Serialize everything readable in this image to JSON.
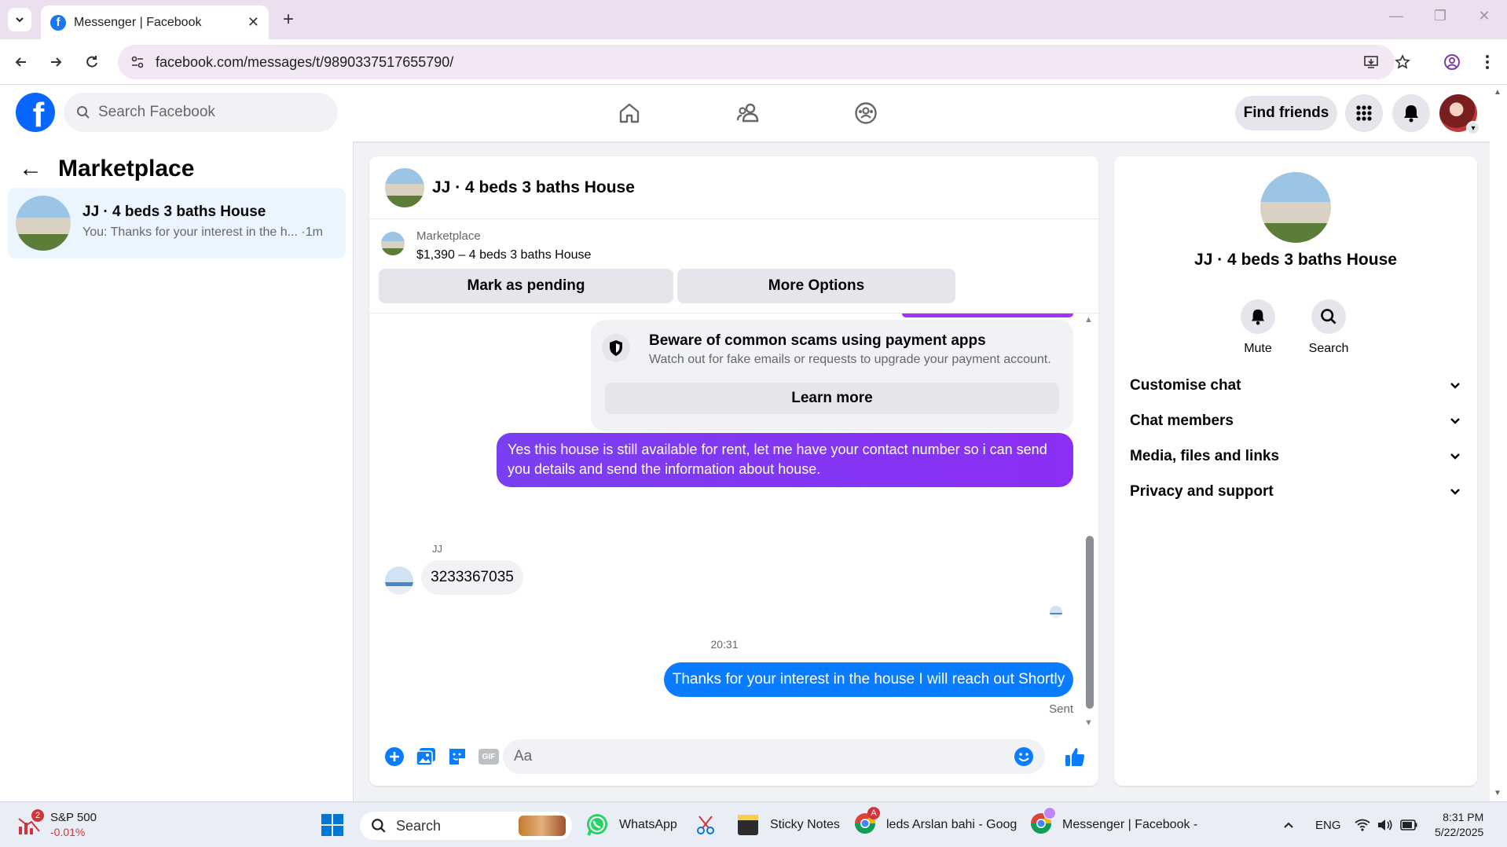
{
  "browser": {
    "tab_title": "Messenger | Facebook",
    "url": "facebook.com/messages/t/9890337517655790/"
  },
  "header": {
    "search_placeholder": "Search Facebook",
    "find_friends": "Find friends",
    "brand_color": "#0866ff"
  },
  "sidebar": {
    "title": "Marketplace",
    "conversations": [
      {
        "name": "JJ · 4 beds 3 baths House",
        "preview": "You: Thanks for your interest in the h...",
        "time": "·1m"
      }
    ]
  },
  "chat": {
    "title": "JJ · 4 beds 3 baths House",
    "listing_source": "Marketplace",
    "listing_price": "$1,390 – 4 beds 3 baths House",
    "btn_pending": "Mark as pending",
    "btn_more": "More Options",
    "scam_title": "Beware of common scams using payment apps",
    "scam_text": "Watch out for fake emails or requests to upgrade your payment account.",
    "learn_more": "Learn more",
    "msg_out_1": "Yes this house is still available for rent, let me have your contact number so i can send you details and send the information about house.",
    "sender": "JJ",
    "msg_in_1": "3233367035",
    "timestamp": "20:31",
    "msg_out_2": "Thanks for your interest in the house I will reach out Shortly",
    "status": "Sent",
    "composer_placeholder": "Aa",
    "gif_label": "GIF",
    "outgoing_color": "#0a7cff",
    "purple_color": "#8b2ff5"
  },
  "info_panel": {
    "name": "JJ · 4 beds 3 baths House",
    "mute": "Mute",
    "search": "Search",
    "sections": [
      "Customise chat",
      "Chat members",
      "Media, files and links",
      "Privacy and support"
    ]
  },
  "taskbar": {
    "stock_name": "S&P 500",
    "stock_change": "-0.01%",
    "stock_badge": "2",
    "search": "Search",
    "apps": [
      "WhatsApp",
      "Sticky Notes",
      "leds Arslan bahi - Goog",
      "Messenger | Facebook -"
    ],
    "chrome_badge": "A",
    "lang": "ENG",
    "time": "8:31 PM",
    "date": "5/22/2025"
  }
}
